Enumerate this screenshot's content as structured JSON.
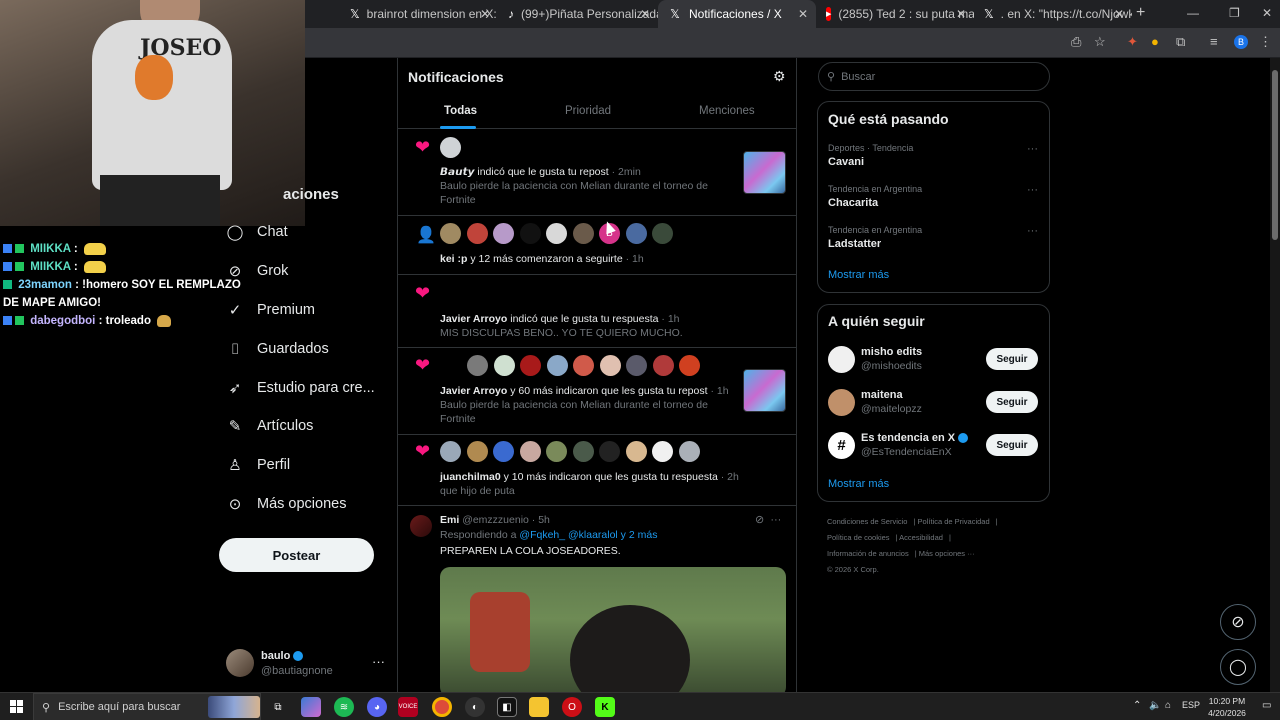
{
  "browser": {
    "tabs": [
      {
        "title": "brainrot dimension en X: \"http...",
        "icon": "x-logo-icon",
        "active": false
      },
      {
        "title": "(99+)Piñata Personalizada Bart...",
        "icon": "tiktok-icon",
        "active": false
      },
      {
        "title": "Notificaciones / X",
        "icon": "x-logo-icon",
        "active": true
      },
      {
        "title": "(2855) Ted 2 : su puta madre - Y...",
        "icon": "youtube-icon",
        "active": false
      },
      {
        "title": ". en X: \"https://t.co/NjowkVj3W...",
        "icon": "x-logo-icon",
        "active": false
      }
    ],
    "new_tab_label": "+"
  },
  "stream_chat": [
    {
      "user": "MIIKKA",
      "message": ""
    },
    {
      "user": "MIIKKA",
      "message": ""
    },
    {
      "user": "23mamon",
      "message": "!homero SOY EL REMPLAZO DE MAPE AMIGO!"
    },
    {
      "user": "dabegodboi",
      "message": "troleado"
    }
  ],
  "webcam": {
    "shirt_text": "JOSEO"
  },
  "nav": {
    "partial_label": "aciones",
    "items": [
      {
        "label": "Chat",
        "icon": "chat-icon"
      },
      {
        "label": "Grok",
        "icon": "grok-icon"
      },
      {
        "label": "Premium",
        "icon": "premium-icon"
      },
      {
        "label": "Guardados",
        "icon": "bookmark-icon"
      },
      {
        "label": "Estudio para cre...",
        "icon": "rocket-icon"
      },
      {
        "label": "Artículos",
        "icon": "article-icon"
      },
      {
        "label": "Perfil",
        "icon": "profile-icon"
      },
      {
        "label": "Más opciones",
        "icon": "more-options-icon"
      }
    ],
    "post_button": "Postear",
    "account": {
      "name": "baulo",
      "handle": "@bautiagnone"
    }
  },
  "main": {
    "title": "Notificaciones",
    "tabs": [
      "Todas",
      "Prioridad",
      "Menciones"
    ],
    "notifications": [
      {
        "actor": "𝘽𝙖𝙪𝙩𝙮",
        "action": " indicó que le gusta tu repost",
        "time": "· 2min",
        "text": "Baulo pierde la paciencia con Melian durante el torneo de Fortnite"
      },
      {
        "actor": "kei :p",
        "action": " y 12 más comenzaron a seguirte",
        "time": "· 1h",
        "text": ""
      },
      {
        "actor": "Javier Arroyo",
        "action": " indicó que le gusta tu respuesta",
        "time": "· 1h",
        "text": "MIS DISCULPAS BENO.. YO TE QUIERO MUCHO."
      },
      {
        "actor": "Javier Arroyo",
        "action": " y 60 más indicaron que les gusta tu repost",
        "time": "· 1h",
        "text": "Baulo pierde la paciencia con Melian durante el torneo de Fortnite"
      },
      {
        "actor": "juanchilma0",
        "action": " y 10 más indicaron que les gusta tu respuesta",
        "time": "· 2h",
        "text": "que hijo de puta"
      }
    ],
    "tweet": {
      "name": "Emi",
      "handle": "@emzzzuenio · 5h",
      "reply_prefix": "Respondiendo a",
      "reply_to": "@Fqkeh_ @klaaralol y 2 más",
      "text": "PREPAREN LA COLA JOSEADORES."
    }
  },
  "sidebar": {
    "search_placeholder": "Buscar",
    "trends_title": "Qué está pasando",
    "trends": [
      {
        "context": "Deportes · Tendencia",
        "name": "Cavani"
      },
      {
        "context": "Tendencia en Argentina",
        "name": "Chacarita"
      },
      {
        "context": "Tendencia en Argentina",
        "name": "Ladstatter"
      }
    ],
    "trends_more": "Mostrar más",
    "follow_title": "A quién seguir",
    "follow": [
      {
        "name": "misho edits",
        "handle": "@mishoedits",
        "button": "Seguir",
        "verified": false
      },
      {
        "name": "maitena",
        "handle": "@maitelopzz",
        "button": "Seguir",
        "verified": false
      },
      {
        "name": "Es tendencia en X",
        "handle": "@EsTendenciaEnX",
        "button": "Seguir",
        "verified": true
      }
    ],
    "follow_more": "Mostrar más",
    "footer": [
      "Condiciones de Servicio",
      "Política de Privacidad",
      "Política de cookies",
      "Accesibilidad",
      "Información de anuncios",
      "Más opciones ···",
      "© 2026 X Corp."
    ]
  },
  "taskbar": {
    "search_placeholder": "Escribe aquí para buscar",
    "language": "ESP",
    "time": "10:20 PM",
    "date": "4/20/2026"
  },
  "colors": {
    "accent": "#1d9bf0",
    "like": "#f91880",
    "background": "#000000"
  }
}
